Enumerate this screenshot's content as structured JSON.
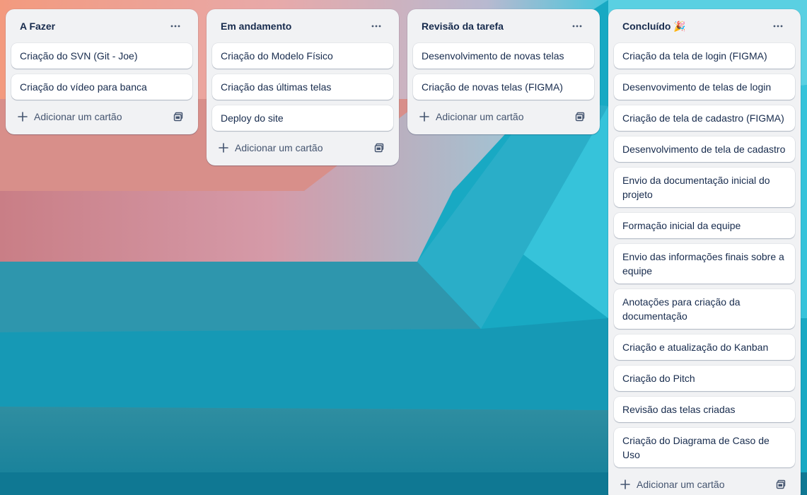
{
  "colors": {
    "list_bg": "#f1f2f4",
    "card_bg": "#ffffff",
    "text": "#172b4d",
    "muted": "#44546f"
  },
  "icons": {
    "list_menu": "ellipsis-icon",
    "add": "plus-icon",
    "template": "card-template-icon"
  },
  "lists": [
    {
      "title": "A Fazer",
      "cards": [
        "Criação do SVN (Git - Joe)",
        "Criação do vídeo para banca"
      ],
      "add_label": "Adicionar um cartão"
    },
    {
      "title": "Em andamento",
      "cards": [
        "Criação do Modelo Físico",
        "Criação das últimas telas",
        "Deploy do site"
      ],
      "add_label": "Adicionar um cartão"
    },
    {
      "title": "Revisão da tarefa",
      "cards": [
        "Desenvolvimento de novas telas",
        "Criação de novas telas (FIGMA)"
      ],
      "add_label": "Adicionar um cartão"
    },
    {
      "title": "Concluído 🎉",
      "cards": [
        "Criação da tela de login (FIGMA)",
        "Desenvovimento de telas de login",
        "Criação de tela de cadastro (FIGMA)",
        "Desenvolvimento de tela de cadastro",
        "Envio da documentação inicial do projeto",
        "Formação inicial da equipe",
        "Envio das informações finais sobre a equipe",
        "Anotações para criação da documentação",
        "Criação e atualização do Kanban",
        "Criação do Pitch",
        "Revisão das telas criadas",
        "Criação do Diagrama de Caso de Uso"
      ],
      "add_label": "Adicionar um cartão"
    }
  ]
}
